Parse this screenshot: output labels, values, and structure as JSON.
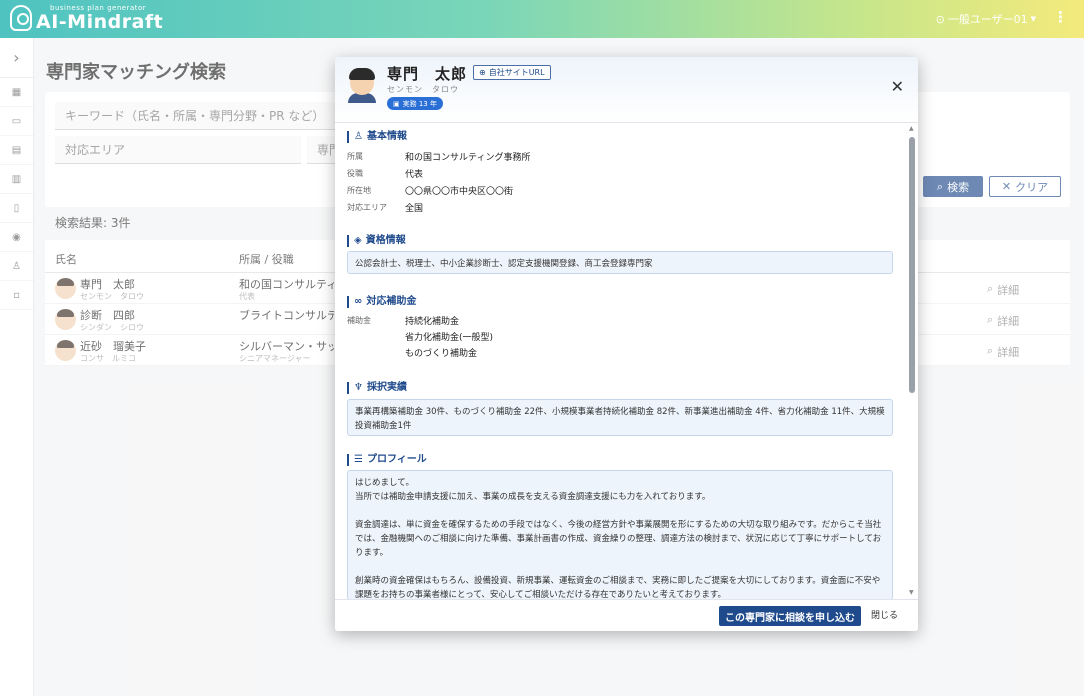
{
  "header": {
    "logo_sub": "business plan generator",
    "logo_title": "AI-Mindraft",
    "user_label": "一般ユーザー01",
    "user_icon": "user-circle-icon",
    "menu_icon": "kebab-icon"
  },
  "sidebar": {
    "toggle": "›",
    "items": [
      "dashboard-icon",
      "chat-icon",
      "document-icon",
      "building-icon",
      "file-icon",
      "person-icon",
      "expert-icon",
      "video-icon"
    ]
  },
  "page": {
    "title": "専門家マッチング検索",
    "search": {
      "keyword_placeholder": "キーワード（氏名・所属・専門分野・PR など）",
      "area_placeholder": "対応エリア",
      "field_placeholder": "専門",
      "search_label": "検索",
      "clear_label": "クリア"
    },
    "result_count": "検索結果: 3件",
    "table": {
      "headers": {
        "name": "氏名",
        "org": "所属 / 役職"
      },
      "detail_label": "詳細",
      "rows": [
        {
          "name": "専門　太郎",
          "kana": "センモン　タロウ",
          "org": "和の国コンサルティ",
          "role": "代表"
        },
        {
          "name": "診断　四郎",
          "kana": "シンダン　シロウ",
          "org": "ブライトコンサルテ",
          "role": ""
        },
        {
          "name": "近砂　瑠美子",
          "kana": "コンサ　ルミコ",
          "org": "シルバーマン・サッ",
          "role": "シニアマネージャー"
        }
      ]
    }
  },
  "modal": {
    "name": "専門　太郎",
    "kana": "センモン　タロウ",
    "url_label": "自社サイトURL",
    "years_label": "実務 13 年",
    "sections": {
      "basic": {
        "title": "基本情報",
        "rows": [
          {
            "label": "所属",
            "value": "和の国コンサルティング事務所"
          },
          {
            "label": "役職",
            "value": "代表"
          },
          {
            "label": "所在地",
            "value": "〇〇県〇〇市中央区〇〇街"
          },
          {
            "label": "対応エリア",
            "value": "全国"
          }
        ]
      },
      "qualifications": {
        "title": "資格情報",
        "text": "公認会計士、税理士、中小企業診断士、認定支援機関登録、商工会登録専門家"
      },
      "subsidies": {
        "title": "対応補助金",
        "label": "補助金",
        "items": [
          "持続化補助金",
          "省力化補助金(一般型)",
          "ものづくり補助金"
        ]
      },
      "results": {
        "title": "採択実績",
        "text": "事業再構築補助金 30件、ものづくり補助金 22件、小規模事業者持続化補助金 82件、新事業進出補助金 4件、省力化補助金 11件、大規模投資補助金1件"
      },
      "profile": {
        "title": "プロフィール",
        "paragraphs": [
          "はじめまして。",
          "当所では補助金申請支援に加え、事業の成長を支える資金調達支援にも力を入れております。",
          "",
          "資金調達は、単に資金を確保するための手段ではなく、今後の経営方針や事業展開を形にするための大切な取り組みです。だからこそ当社では、金融機関へのご相談に向けた準備、事業計画書の作成、資金繰りの整理、調達方法の検討まで、状況に応じて丁寧にサポートしております。",
          "",
          "創業時の資金確保はもちろん、設備投資、新規事業、運転資金のご相談まで、実務に即したご提案を大切にしております。資金面に不安や課題をお持ちの事業者様にとって、安心してご相談いただける存在でありたいと考えております。"
        ]
      }
    },
    "consult_label": "この専門家に相談を申し込む",
    "close_label": "閉じる"
  }
}
